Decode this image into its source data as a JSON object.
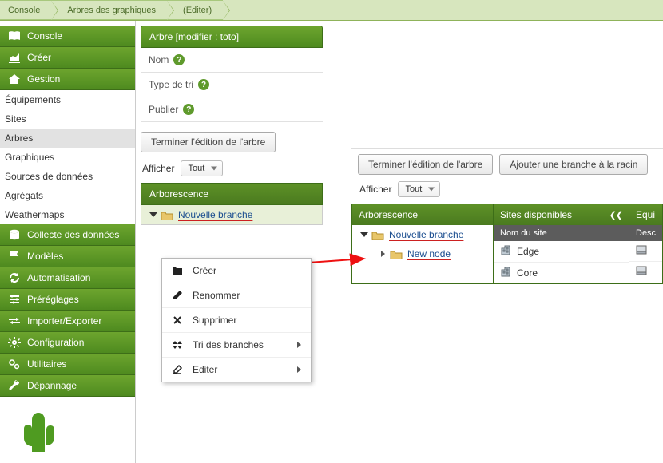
{
  "breadcrumb": [
    "Console",
    "Arbres des graphiques",
    "(Editer)"
  ],
  "sidebar": {
    "groups": [
      {
        "label": "Console",
        "icon": "book"
      },
      {
        "label": "Créer",
        "icon": "chart"
      },
      {
        "label": "Gestion",
        "icon": "home"
      }
    ],
    "mgmt_items": [
      "Équipements",
      "Sites",
      "Arbres",
      "Graphiques",
      "Sources de données",
      "Agrégats",
      "Weathermaps"
    ],
    "groups2": [
      {
        "label": "Collecte des données",
        "icon": "db"
      },
      {
        "label": "Modèles",
        "icon": "flag"
      },
      {
        "label": "Automatisation",
        "icon": "gear"
      },
      {
        "label": "Préréglages",
        "icon": "sliders"
      },
      {
        "label": "Importer/Exporter",
        "icon": "arrows"
      },
      {
        "label": "Configuration",
        "icon": "cog"
      },
      {
        "label": "Utilitaires",
        "icon": "gears"
      },
      {
        "label": "Dépannage",
        "icon": "wrench"
      }
    ]
  },
  "main": {
    "header": "Arbre [modifier : toto]",
    "fields": {
      "name": "Nom",
      "sort": "Type de tri",
      "publish": "Publier"
    },
    "finish_btn": "Terminer l'édition de l'arbre",
    "filter_label": "Afficher",
    "filter_value": "Tout",
    "tree_header": "Arborescence",
    "node1": "Nouvelle branche"
  },
  "ctx": {
    "create": "Créer",
    "rename": "Renommer",
    "delete": "Supprimer",
    "sort": "Tri des branches",
    "edit": "Editer"
  },
  "right": {
    "finish_btn": "Terminer l'édition de l'arbre",
    "add_branch_btn": "Ajouter une branche à la racin",
    "filter_label": "Afficher",
    "filter_value": "Tout",
    "col_tree": "Arborescence",
    "col_sites": "Sites disponibles",
    "col_equip": "Equi",
    "sub_site": "Nom du site",
    "sub_desc": "Desc",
    "node1": "Nouvelle branche",
    "node2": "New node",
    "sites": [
      "Edge",
      "Core"
    ]
  }
}
